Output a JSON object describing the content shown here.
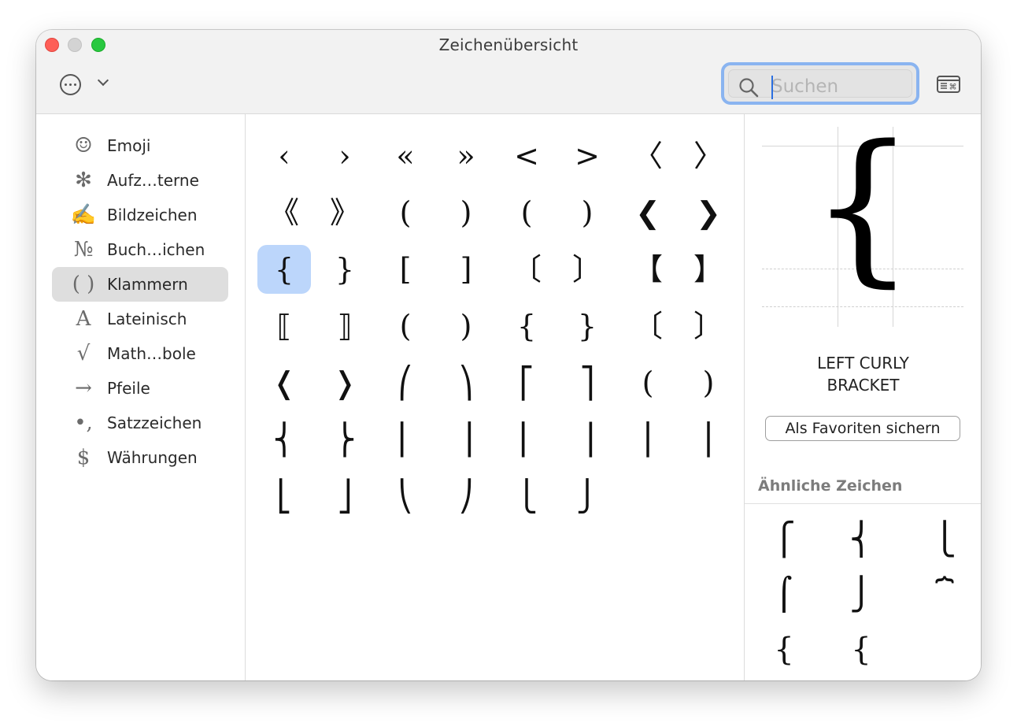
{
  "window": {
    "title": "Zeichenübersicht"
  },
  "toolbar": {
    "more_icon": "ellipsis-circle-icon",
    "dropdown_icon": "chevron-down-icon",
    "keyboard_icon": "keyboard-window-icon"
  },
  "search": {
    "placeholder": "Suchen",
    "value": ""
  },
  "sidebar": {
    "selected": "Klammern",
    "items": [
      {
        "icon": "☺",
        "label": "Emoji"
      },
      {
        "icon": "✻",
        "label": "Aufz…terne"
      },
      {
        "icon": "✍",
        "label": "Bildzeichen"
      },
      {
        "icon": "№",
        "label": "Buch…ichen"
      },
      {
        "icon": "( )",
        "label": "Klammern"
      },
      {
        "icon": "A",
        "label": "Lateinisch"
      },
      {
        "icon": "√",
        "label": "Math…bole"
      },
      {
        "icon": "→",
        "label": "Pfeile"
      },
      {
        "icon": "•,",
        "label": "Satzzeichen"
      },
      {
        "icon": "$",
        "label": "Währungen"
      }
    ]
  },
  "grid": {
    "selected": "{",
    "rows": [
      [
        "‹",
        "›",
        "«",
        "»",
        "<",
        ">",
        "〈",
        "〉"
      ],
      [
        "《",
        "》",
        "(",
        ")",
        "(",
        ")",
        "❮",
        "❯"
      ],
      [
        "{",
        "}",
        "[",
        "]",
        "〔",
        "〕",
        "【",
        "】"
      ],
      [
        "⟦",
        "⟧",
        "(",
        ")",
        "{",
        "}",
        "〔",
        "〕"
      ],
      [
        "❬",
        "❭",
        "⎛",
        "⎞",
        "⎡",
        "⎤",
        "(",
        ")"
      ],
      [
        "⎨",
        "⎬",
        "⎜",
        "⎟",
        "⎢",
        "⎥",
        "⎪",
        "⎪"
      ],
      [
        "⎣",
        "⎦",
        "⎝",
        "⎠",
        "⎩",
        "⎭"
      ]
    ]
  },
  "detail": {
    "glyph": "{",
    "name": "LEFT CURLY\nBRACKET",
    "favorite_button": "Als Favoriten sichern",
    "similar_header": "Ähnliche Zeichen",
    "similar": [
      "⎧",
      "⎨",
      "⎩",
      "⌠",
      "⎭",
      "⏞",
      "{",
      "{"
    ]
  }
}
